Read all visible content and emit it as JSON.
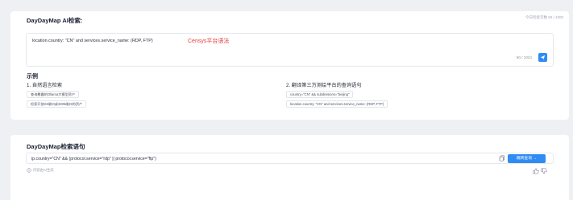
{
  "ai_search": {
    "title": "DayDayMap AI检索:",
    "usage": "今日检索次数 60 / 1000",
    "query": "location.country: \"CN\" and services.service_name: (RDP, FTP)",
    "hint": "Censys平台语法",
    "char_count": "60 / 1024"
  },
  "examples": {
    "heading": "示例",
    "col1_title": "1. 自然语言检索",
    "col1_items": [
      "查询暴露的Ollama大模型资产",
      "检索开放22端口或3306端口的资产"
    ],
    "col2_title": "2. 翻译第三方测绘平台的查询语句",
    "col2_items": [
      "country=\"CN\" && subdivisions=\"beijing\"",
      "location.country: \"CN\" and services.service_name: (RDP, FTP)"
    ]
  },
  "result": {
    "title": "DayDayMap检索语句",
    "query": "ip.country=\"CN\" && (protocol.service=\"rdp\" || protocol.service=\"ftp\")",
    "jump_label": "跳转查询 →",
    "ai_note": "内容由AI生成"
  },
  "icons": {
    "send": "send-icon",
    "copy": "copy-icon",
    "info": "info-icon",
    "like": "thumbs-up-icon",
    "dislike": "thumbs-down-icon"
  },
  "colors": {
    "accent": "#2f8cf5",
    "hint": "#e43b3b",
    "background": "#eef0f4"
  }
}
